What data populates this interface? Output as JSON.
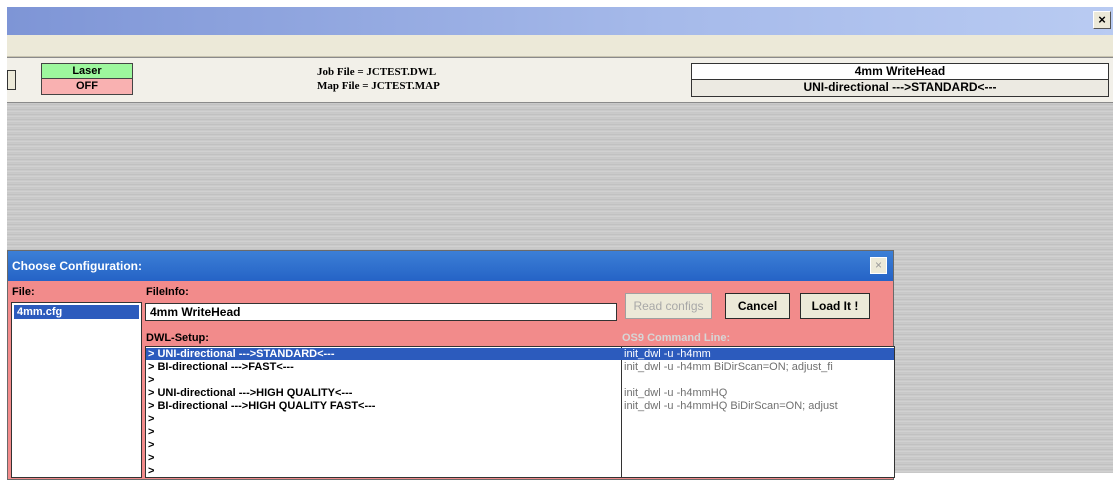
{
  "window": {
    "close_glyph": "×"
  },
  "status": {
    "laser_label": "Laser",
    "laser_state": "OFF",
    "job_file": "Job File = JCTEST.DWL",
    "map_file": "Map File = JCTEST.MAP",
    "head_name": "4mm WriteHead",
    "head_mode": "UNI-directional --->STANDARD<---"
  },
  "dialog": {
    "title": "Choose Configuration:",
    "close_glyph": "×",
    "file_label": "File:",
    "files": [
      "4mm.cfg"
    ],
    "fileinfo_label": "FileInfo:",
    "fileinfo_value": "4mm WriteHead",
    "buttons": {
      "read": "Read configs",
      "cancel": "Cancel",
      "load": "Load It !"
    },
    "dwl_label": "DWL-Setup:",
    "os9_label": "OS9 Command Line:",
    "rows": [
      {
        "setup": "> UNI-directional --->STANDARD<---",
        "cmd": "init_dwl -u -h4mm",
        "selected": true
      },
      {
        "setup": "> BI-directional --->FAST<---",
        "cmd": "init_dwl -u -h4mm BiDirScan=ON; adjust_fi",
        "selected": false
      },
      {
        "setup": ">",
        "cmd": "",
        "selected": false
      },
      {
        "setup": "> UNI-directional --->HIGH QUALITY<---",
        "cmd": "init_dwl -u -h4mmHQ",
        "selected": false
      },
      {
        "setup": "> BI-directional --->HIGH QUALITY FAST<---",
        "cmd": "init_dwl -u -h4mmHQ BiDirScan=ON; adjust",
        "selected": false
      },
      {
        "setup": ">",
        "cmd": "",
        "selected": false
      },
      {
        "setup": ">",
        "cmd": "",
        "selected": false
      },
      {
        "setup": ">",
        "cmd": "",
        "selected": false
      },
      {
        "setup": ">",
        "cmd": "",
        "selected": false
      },
      {
        "setup": ">",
        "cmd": "",
        "selected": false
      }
    ]
  }
}
